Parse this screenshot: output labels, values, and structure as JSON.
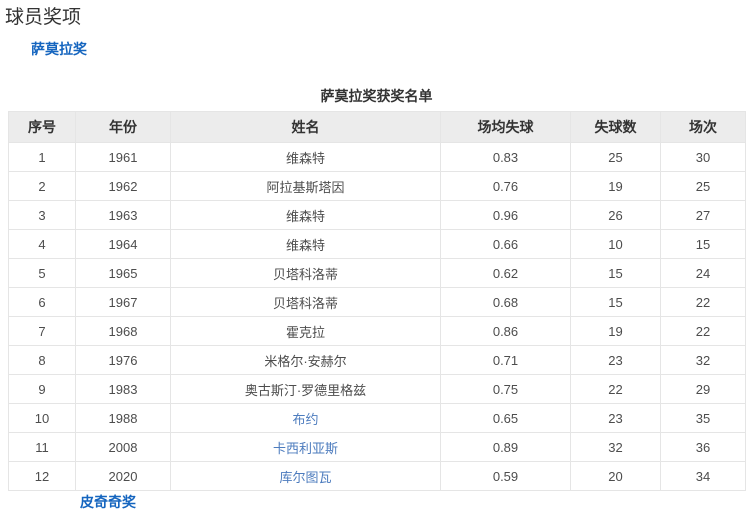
{
  "page": {
    "title": "球员奖项"
  },
  "section": {
    "link_label": "萨莫拉奖"
  },
  "table": {
    "caption": "萨莫拉奖获奖名单",
    "headers": [
      "序号",
      "年份",
      "姓名",
      "场均失球",
      "失球数",
      "场次"
    ],
    "rows": [
      {
        "no": "1",
        "year": "1961",
        "name": "维森特",
        "avg": "0.83",
        "conceded": "25",
        "matches": "30",
        "name_is_link": false
      },
      {
        "no": "2",
        "year": "1962",
        "name": "阿拉基斯塔因",
        "avg": "0.76",
        "conceded": "19",
        "matches": "25",
        "name_is_link": false
      },
      {
        "no": "3",
        "year": "1963",
        "name": "维森特",
        "avg": "0.96",
        "conceded": "26",
        "matches": "27",
        "name_is_link": false
      },
      {
        "no": "4",
        "year": "1964",
        "name": "维森特",
        "avg": "0.66",
        "conceded": "10",
        "matches": "15",
        "name_is_link": false
      },
      {
        "no": "5",
        "year": "1965",
        "name": "贝塔科洛蒂",
        "avg": "0.62",
        "conceded": "15",
        "matches": "24",
        "name_is_link": false
      },
      {
        "no": "6",
        "year": "1967",
        "name": "贝塔科洛蒂",
        "avg": "0.68",
        "conceded": "15",
        "matches": "22",
        "name_is_link": false
      },
      {
        "no": "7",
        "year": "1968",
        "name": "霍克拉",
        "avg": "0.86",
        "conceded": "19",
        "matches": "22",
        "name_is_link": false
      },
      {
        "no": "8",
        "year": "1976",
        "name": "米格尔·安赫尔",
        "avg": "0.71",
        "conceded": "23",
        "matches": "32",
        "name_is_link": false
      },
      {
        "no": "9",
        "year": "1983",
        "name": "奥古斯汀·罗德里格兹",
        "avg": "0.75",
        "conceded": "22",
        "matches": "29",
        "name_is_link": false
      },
      {
        "no": "10",
        "year": "1988",
        "name": "布约",
        "avg": "0.65",
        "conceded": "23",
        "matches": "35",
        "name_is_link": true
      },
      {
        "no": "11",
        "year": "2008",
        "name": "卡西利亚斯",
        "avg": "0.89",
        "conceded": "32",
        "matches": "36",
        "name_is_link": true
      },
      {
        "no": "12",
        "year": "2020",
        "name": "库尔图瓦",
        "avg": "0.59",
        "conceded": "20",
        "matches": "34",
        "name_is_link": true
      }
    ]
  },
  "bottom": {
    "partial_link_label": "皮奇奇奖"
  },
  "colors": {
    "section_link": "#1565bf",
    "table_link": "#4d7cbe",
    "header_bg": "#ececec",
    "border": "#e5e5e5",
    "cell_text": "#4d4d4d",
    "title_text": "#333333"
  }
}
